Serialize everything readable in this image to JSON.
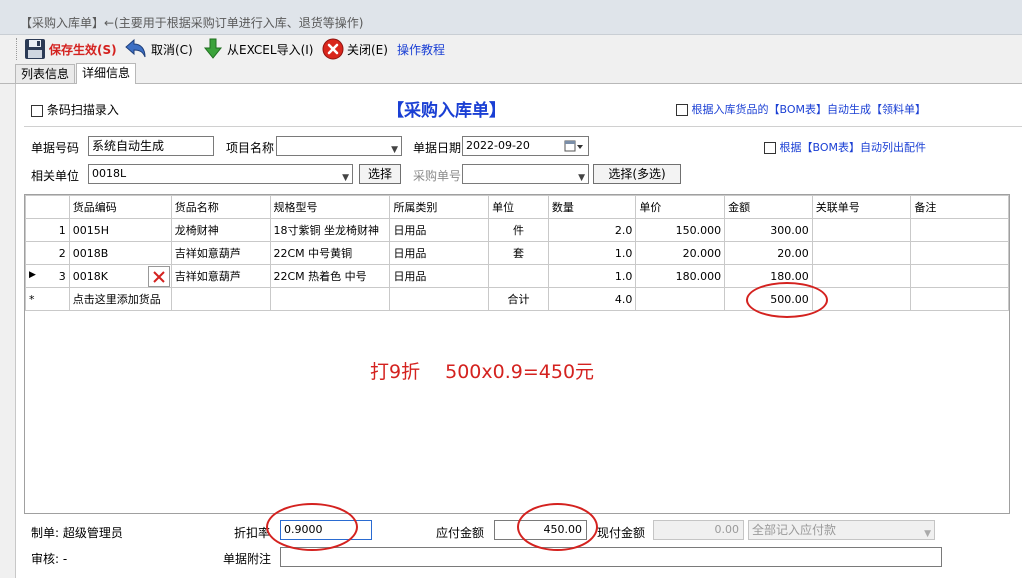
{
  "window": {
    "title": "【采购入库单】←(主要用于根据采购订单进行入库、退货等操作)"
  },
  "toolbar": {
    "save": "保存生效(S)",
    "cancel": "取消(C)",
    "import": "从EXCEL导入(I)",
    "close": "关闭(E)",
    "tutorial": "操作教程"
  },
  "tabs": [
    {
      "label": "列表信息"
    },
    {
      "label": "详细信息"
    }
  ],
  "form": {
    "barcode_scan": "条码扫描录入",
    "heading": "【采购入库单】",
    "auto_gen_bom": "根据入库货品的【BOM表】自动生成【领料单】",
    "doc_no_label": "单据号码",
    "doc_no_value": "系统自动生成",
    "project_label": "项目名称",
    "project_value": "",
    "date_label": "单据日期",
    "date_value": "2022-09-20",
    "bom_list": "根据【BOM表】自动列出配件",
    "unit_label": "相关单位",
    "unit_value": "0018L",
    "select_btn": "选择",
    "po_label": "采购单号",
    "po_value": "",
    "select_multi_btn": "选择(多选)"
  },
  "table": {
    "headers": [
      "货品编码",
      "货品名称",
      "规格型号",
      "所属类别",
      "单位",
      "数量",
      "单价",
      "金额",
      "关联单号",
      "备注"
    ],
    "rows": [
      {
        "idx": "1",
        "code": "0015H",
        "name": "龙椅财神",
        "spec": "18寸紫铜 坐龙椅财神",
        "cat": "日用品",
        "unit": "件",
        "qty": "2.0",
        "price": "150.000",
        "amount": "300.00",
        "ref": "",
        "note": ""
      },
      {
        "idx": "2",
        "code": "0018B",
        "name": "吉祥如意葫芦",
        "spec": "22CM 中号黄铜",
        "cat": "日用品",
        "unit": "套",
        "qty": "1.0",
        "price": "20.000",
        "amount": "20.00",
        "ref": "",
        "note": ""
      },
      {
        "idx": "3",
        "code": "0018K",
        "name": "吉祥如意葫芦",
        "spec": "22CM 热着色 中号",
        "cat": "日用品",
        "unit": "",
        "qty": "1.0",
        "price": "180.000",
        "amount": "180.00",
        "ref": "",
        "note": ""
      }
    ],
    "new_row_marker": "*",
    "add_hint": "点击这里添加货品",
    "total_label": "合计",
    "total_qty": "4.0",
    "total_amount": "500.00"
  },
  "annotation": "打9折　 500x0.9=450元",
  "footer": {
    "maker_label": "制单:",
    "maker_value": "超级管理员",
    "auditor_label": "审核:",
    "auditor_value": "-",
    "discount_label": "折扣率",
    "discount_value": "0.9000",
    "payable_label": "应付金额",
    "payable_value": "450.00",
    "cash_label": "现付金额",
    "cash_value": "0.00",
    "payment_mode": "全部记入应付款",
    "note_label": "单据附注",
    "note_value": ""
  },
  "colors": {
    "accent_blue": "#1a3fd4",
    "annotation_red": "#d4221f",
    "save_red": "#d4221f"
  }
}
